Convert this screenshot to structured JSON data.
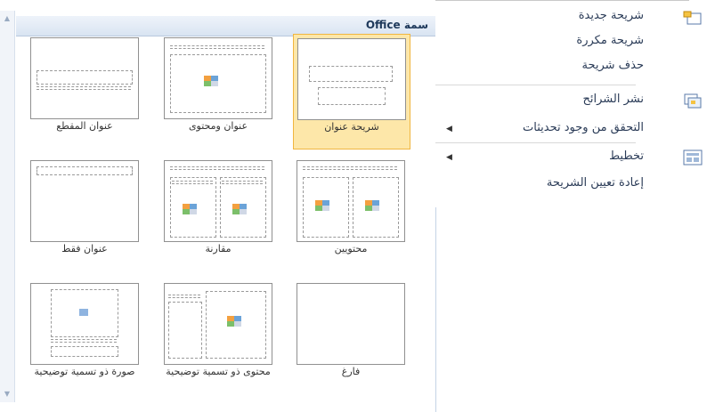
{
  "gallery": {
    "header": "سمة Office",
    "tiles": [
      {
        "label": "شريحة عنوان"
      },
      {
        "label": "عنوان ومحتوى"
      },
      {
        "label": "عنوان المقطع"
      },
      {
        "label": "محتويين"
      },
      {
        "label": "مقارنة"
      },
      {
        "label": "عنوان فقط"
      },
      {
        "label": "فارغ"
      },
      {
        "label": "محتوى ذو تسمية توضيحية"
      },
      {
        "label": "صورة ذو تسمية توضيحية"
      }
    ],
    "selected_index": 0
  },
  "menu": {
    "items": [
      {
        "label": "شريحة جديدة"
      },
      {
        "label": "شريحة مكررة"
      },
      {
        "label": "حذف شريحة"
      },
      {
        "label": "نشر الشرائح"
      },
      {
        "label": "التحقق من وجود تحديثات"
      },
      {
        "label": "تخطيط"
      },
      {
        "label": "إعادة تعيين الشريحة"
      }
    ]
  },
  "colors": {
    "selected_fill": "#fde7a9",
    "selected_border": "#f0b640",
    "header_text": "#1e395b"
  }
}
